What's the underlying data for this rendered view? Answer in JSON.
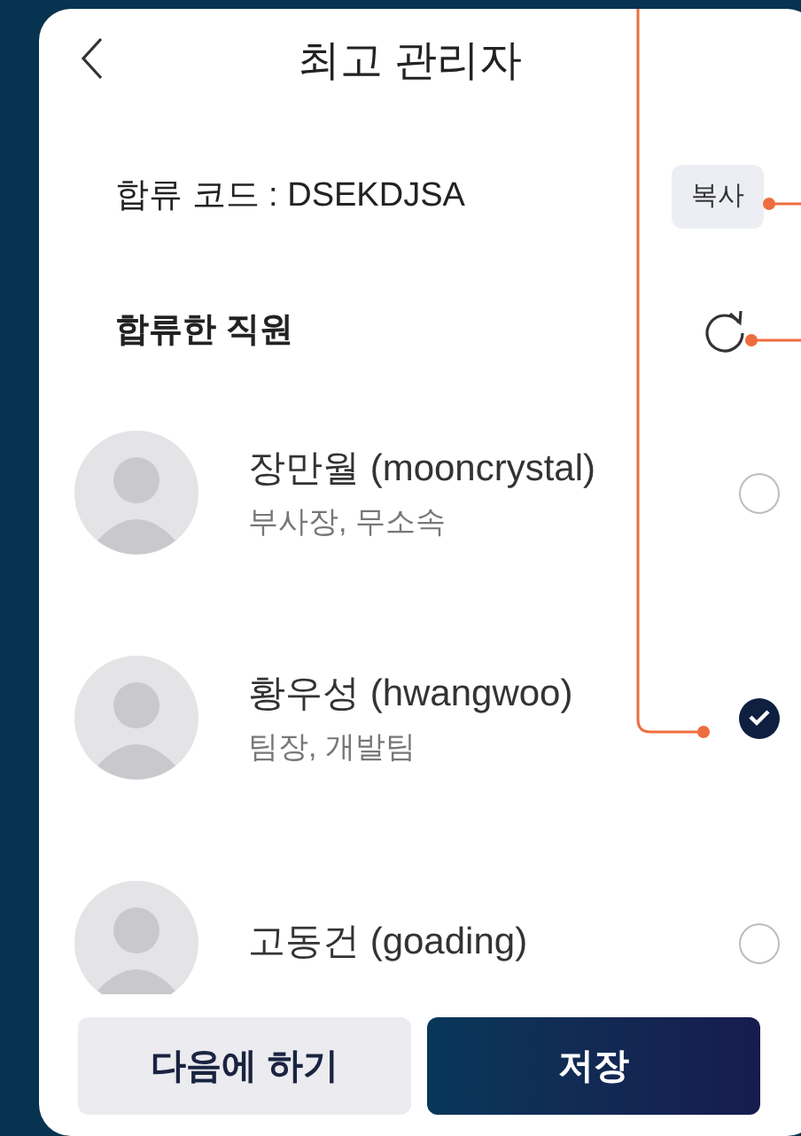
{
  "header": {
    "title": "최고 관리자"
  },
  "join_code": {
    "label": "합류 코드 : DSEKDJSA",
    "copy_button": "복사"
  },
  "section": {
    "title": "합류한 직원"
  },
  "employees": [
    {
      "name": "장만월 (mooncrystal)",
      "role": "부사장, 무소속",
      "selected": false
    },
    {
      "name": "황우성 (hwangwoo)",
      "role": "팀장, 개발팀",
      "selected": true
    },
    {
      "name": "고동건 (goading)",
      "selected": false
    }
  ],
  "buttons": {
    "later": "다음에 하기",
    "save": "저장"
  }
}
